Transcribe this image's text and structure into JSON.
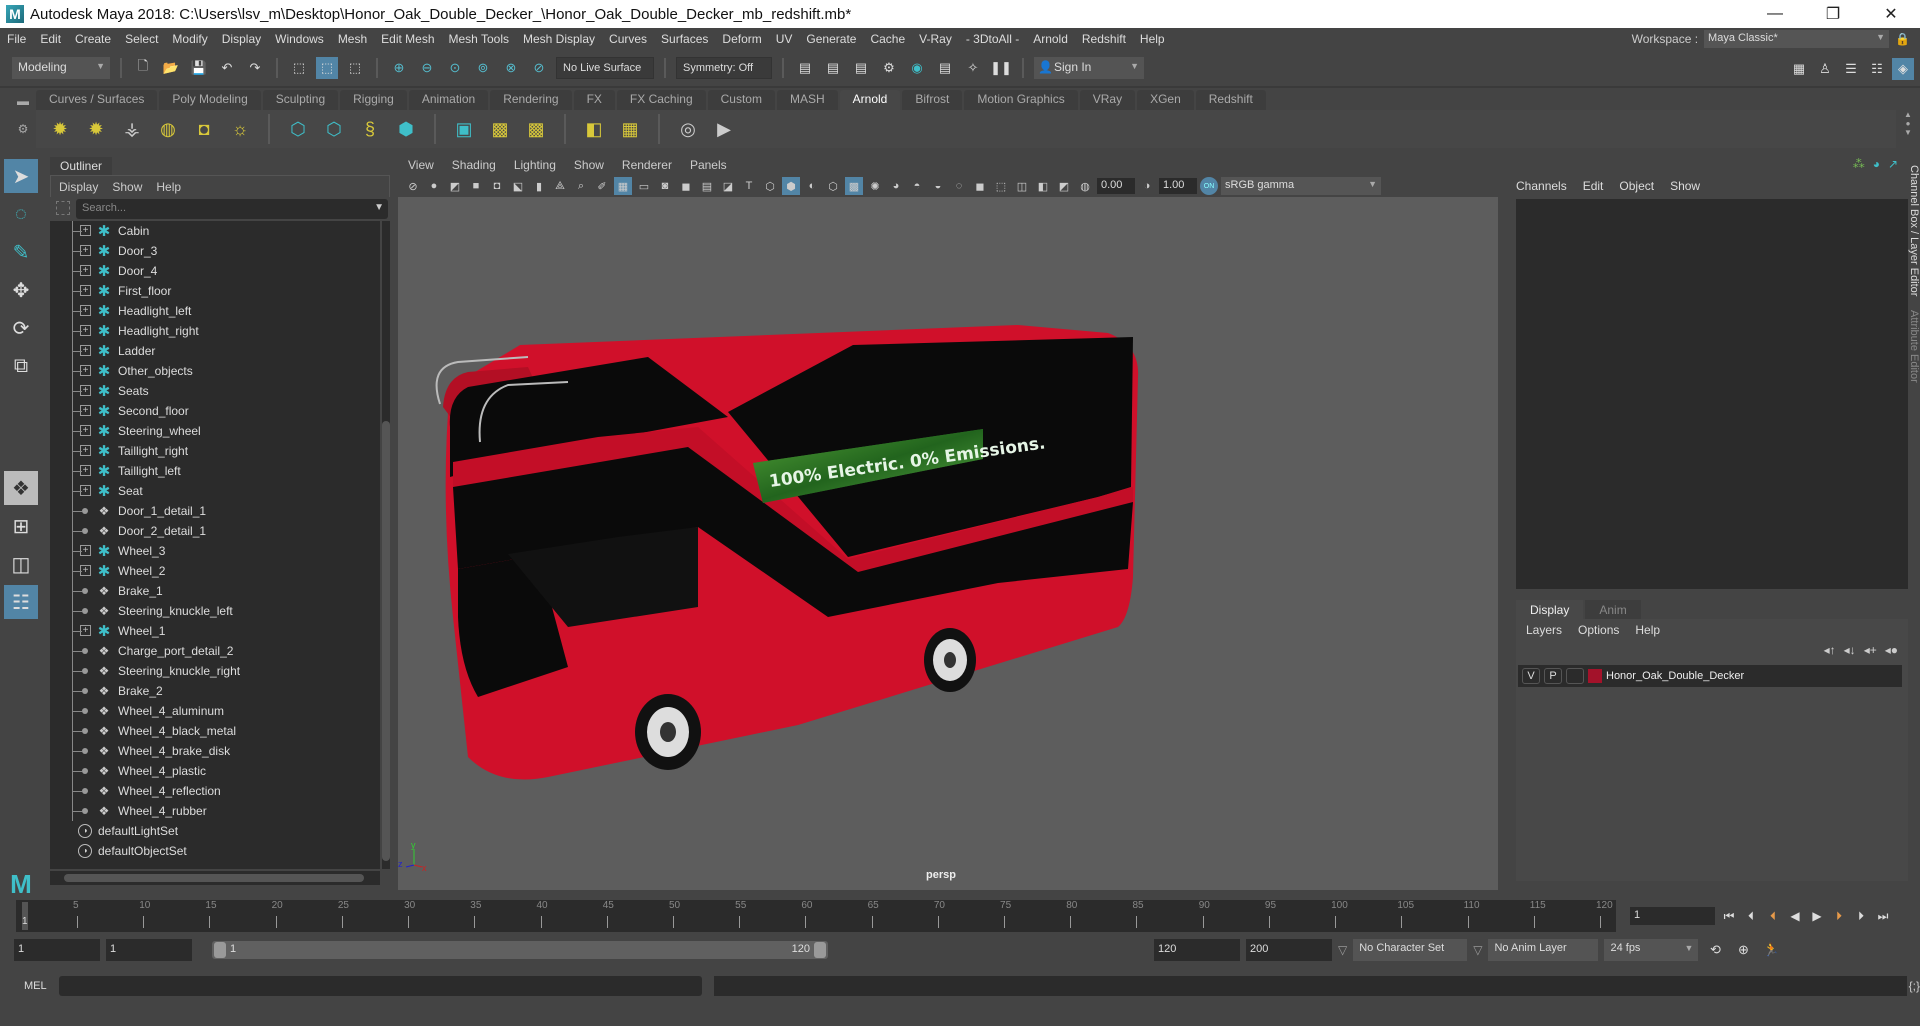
{
  "window": {
    "title": "Autodesk Maya 2018: C:\\Users\\lsv_m\\Desktop\\Honor_Oak_Double_Decker_\\Honor_Oak_Double_Decker_mb_redshift.mb*",
    "logo": "M",
    "minimize_icon": "—",
    "restore_icon": "❐",
    "close_icon": "✕"
  },
  "menubar": {
    "items": [
      "File",
      "Edit",
      "Create",
      "Select",
      "Modify",
      "Display",
      "Windows",
      "Mesh",
      "Edit Mesh",
      "Mesh Tools",
      "Mesh Display",
      "Curves",
      "Surfaces",
      "Deform",
      "UV",
      "Generate",
      "Cache",
      "V-Ray",
      "- 3DtoAll -",
      "Arnold",
      "Redshift",
      "Help"
    ],
    "workspace_label": "Workspace :",
    "workspace_value": "Maya Classic*"
  },
  "statusline": {
    "mode": "Modeling",
    "live_surface": "No Live Surface",
    "symmetry": "Symmetry: Off",
    "sign_in": "Sign In"
  },
  "shelf": {
    "tabs": [
      "Curves / Surfaces",
      "Poly Modeling",
      "Sculpting",
      "Rigging",
      "Animation",
      "Rendering",
      "FX",
      "FX Caching",
      "Custom",
      "MASH",
      "Arnold",
      "Bifrost",
      "Motion Graphics",
      "VRay",
      "XGen",
      "Redshift"
    ],
    "active_tab": "Arnold"
  },
  "outliner": {
    "title": "Outliner",
    "menu": [
      "Display",
      "Show",
      "Help"
    ],
    "search_placeholder": "Search...",
    "items": [
      {
        "name": "Cabin",
        "type": "group"
      },
      {
        "name": "Door_3",
        "type": "group"
      },
      {
        "name": "Door_4",
        "type": "group"
      },
      {
        "name": "First_floor",
        "type": "group"
      },
      {
        "name": "Headlight_left",
        "type": "group"
      },
      {
        "name": "Headlight_right",
        "type": "group"
      },
      {
        "name": "Ladder",
        "type": "group"
      },
      {
        "name": "Other_objects",
        "type": "group"
      },
      {
        "name": "Seats",
        "type": "group"
      },
      {
        "name": "Second_floor",
        "type": "group"
      },
      {
        "name": "Steering_wheel",
        "type": "group"
      },
      {
        "name": "Taillight_right",
        "type": "group"
      },
      {
        "name": "Taillight_left",
        "type": "group"
      },
      {
        "name": "Seat",
        "type": "group"
      },
      {
        "name": "Door_1_detail_1",
        "type": "mesh"
      },
      {
        "name": "Door_2_detail_1",
        "type": "mesh"
      },
      {
        "name": "Wheel_3",
        "type": "group"
      },
      {
        "name": "Wheel_2",
        "type": "group"
      },
      {
        "name": "Brake_1",
        "type": "mesh"
      },
      {
        "name": "Steering_knuckle_left",
        "type": "mesh"
      },
      {
        "name": "Wheel_1",
        "type": "group"
      },
      {
        "name": "Charge_port_detail_2",
        "type": "mesh"
      },
      {
        "name": "Steering_knuckle_right",
        "type": "mesh"
      },
      {
        "name": "Brake_2",
        "type": "mesh"
      },
      {
        "name": "Wheel_4_aluminum",
        "type": "mesh"
      },
      {
        "name": "Wheel_4_black_metal",
        "type": "mesh"
      },
      {
        "name": "Wheel_4_brake_disk",
        "type": "mesh"
      },
      {
        "name": "Wheel_4_plastic",
        "type": "mesh"
      },
      {
        "name": "Wheel_4_reflection",
        "type": "mesh"
      },
      {
        "name": "Wheel_4_rubber",
        "type": "mesh"
      },
      {
        "name": "defaultLightSet",
        "type": "set"
      },
      {
        "name": "defaultObjectSet",
        "type": "set"
      }
    ]
  },
  "viewport": {
    "menu": [
      "View",
      "Shading",
      "Lighting",
      "Show",
      "Renderer",
      "Panels"
    ],
    "exposure": "0.00",
    "gamma": "1.00",
    "color_mgmt_on": "ON",
    "color_space": "sRGB gamma",
    "camera_label": "persp",
    "ad_text": "100% Electric. 0% Emissions.",
    "axis": {
      "x": "x",
      "y": "y",
      "z": "z"
    }
  },
  "channelbox": {
    "menu": [
      "Channels",
      "Edit",
      "Object",
      "Show"
    ]
  },
  "layer_editor": {
    "tabs": [
      "Display",
      "Anim"
    ],
    "active_tab": "Display",
    "menu": [
      "Layers",
      "Options",
      "Help"
    ],
    "layers": [
      {
        "v": "V",
        "p": "P",
        "color": "#a3122a",
        "name": "Honor_Oak_Double_Decker"
      }
    ]
  },
  "side_tabs": [
    "Channel Box / Layer Editor",
    "Attribute Editor"
  ],
  "timeline": {
    "ticks": [
      5,
      10,
      15,
      20,
      25,
      30,
      35,
      40,
      45,
      50,
      55,
      60,
      65,
      70,
      75,
      80,
      85,
      90,
      95,
      100,
      105,
      110,
      115,
      120
    ],
    "min": 1,
    "max": 120,
    "current_frame": "1",
    "current_frame_field": "1"
  },
  "range": {
    "start": "1",
    "playback_start": "1",
    "slider_start": "1",
    "slider_end": "120",
    "playback_end": "120",
    "end": "200",
    "character_set": "No Character Set",
    "anim_layer": "No Anim Layer",
    "fps": "24 fps"
  },
  "commandline": {
    "label": "MEL"
  }
}
